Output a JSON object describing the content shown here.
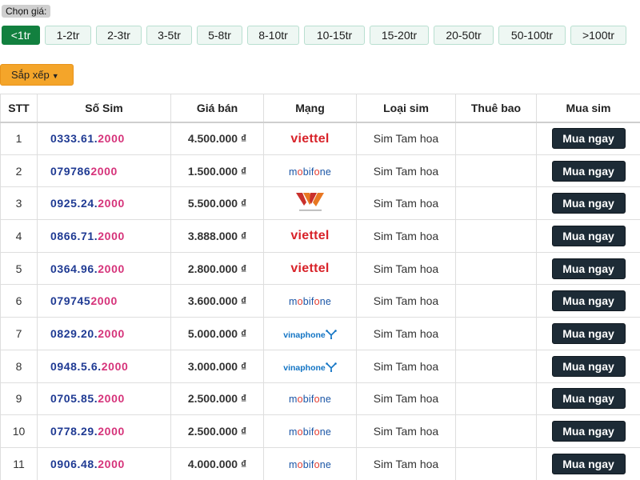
{
  "filters": {
    "label": "Chọn giá:",
    "options": [
      "<1tr",
      "1-2tr",
      "2-3tr",
      "3-5tr",
      "5-8tr",
      "8-10tr",
      "10-15tr",
      "15-20tr",
      "20-50tr",
      "50-100tr",
      ">100tr"
    ],
    "active_index": 0
  },
  "sort": {
    "label": "Sắp xếp",
    "icon": "caret-down-icon"
  },
  "table": {
    "headers": [
      "STT",
      "Số Sim",
      "Giá bán",
      "Mạng",
      "Loại sim",
      "Thuê bao",
      "Mua sim"
    ],
    "rows": [
      {
        "stt": "1",
        "prefix": "0333.61.",
        "suffix": "2000",
        "price": "4.500.000 ₫",
        "network": "viettel",
        "network_label": "viettel",
        "type": "Sim Tam hoa",
        "subscription": "",
        "buy": "Mua ngay"
      },
      {
        "stt": "2",
        "prefix": "079786",
        "suffix": "2000",
        "price": "1.500.000 ₫",
        "network": "mobifone",
        "network_label": "mobifone",
        "type": "Sim Tam hoa",
        "subscription": "",
        "buy": "Mua ngay"
      },
      {
        "stt": "3",
        "prefix": "0925.24.",
        "suffix": "2000",
        "price": "5.500.000 ₫",
        "network": "vietnamobile",
        "network_label": "",
        "type": "Sim Tam hoa",
        "subscription": "",
        "buy": "Mua ngay"
      },
      {
        "stt": "4",
        "prefix": "0866.71.",
        "suffix": "2000",
        "price": "3.888.000 ₫",
        "network": "viettel",
        "network_label": "viettel",
        "type": "Sim Tam hoa",
        "subscription": "",
        "buy": "Mua ngay"
      },
      {
        "stt": "5",
        "prefix": "0364.96.",
        "suffix": "2000",
        "price": "2.800.000 ₫",
        "network": "viettel",
        "network_label": "viettel",
        "type": "Sim Tam hoa",
        "subscription": "",
        "buy": "Mua ngay"
      },
      {
        "stt": "6",
        "prefix": "079745",
        "suffix": "2000",
        "price": "3.600.000 ₫",
        "network": "mobifone",
        "network_label": "mobifone",
        "type": "Sim Tam hoa",
        "subscription": "",
        "buy": "Mua ngay"
      },
      {
        "stt": "7",
        "prefix": "0829.20.",
        "suffix": "2000",
        "price": "5.000.000 ₫",
        "network": "vinaphone",
        "network_label": "vinaphone",
        "type": "Sim Tam hoa",
        "subscription": "",
        "buy": "Mua ngay"
      },
      {
        "stt": "8",
        "prefix": "0948.5.6.",
        "suffix": "2000",
        "price": "3.000.000 ₫",
        "network": "vinaphone",
        "network_label": "vinaphone",
        "type": "Sim Tam hoa",
        "subscription": "",
        "buy": "Mua ngay"
      },
      {
        "stt": "9",
        "prefix": "0705.85.",
        "suffix": "2000",
        "price": "2.500.000 ₫",
        "network": "mobifone",
        "network_label": "mobifone",
        "type": "Sim Tam hoa",
        "subscription": "",
        "buy": "Mua ngay"
      },
      {
        "stt": "10",
        "prefix": "0778.29.",
        "suffix": "2000",
        "price": "2.500.000 ₫",
        "network": "mobifone",
        "network_label": "mobifone",
        "type": "Sim Tam hoa",
        "subscription": "",
        "buy": "Mua ngay"
      },
      {
        "stt": "11",
        "prefix": "0906.48.",
        "suffix": "2000",
        "price": "4.000.000 ₫",
        "network": "mobifone",
        "network_label": "mobifone",
        "type": "Sim Tam hoa",
        "subscription": "",
        "buy": "Mua ngay"
      }
    ]
  },
  "colors": {
    "active_filter": "#12803f",
    "filter_bg": "#eef7f3",
    "sort_button": "#f4a52a",
    "buy_button": "#1d2b36",
    "number_prefix": "#1f3a93",
    "number_suffix": "#d6337a",
    "viettel": "#d8232a",
    "mobifone": "#1a55a5",
    "vinaphone": "#1274c4"
  }
}
